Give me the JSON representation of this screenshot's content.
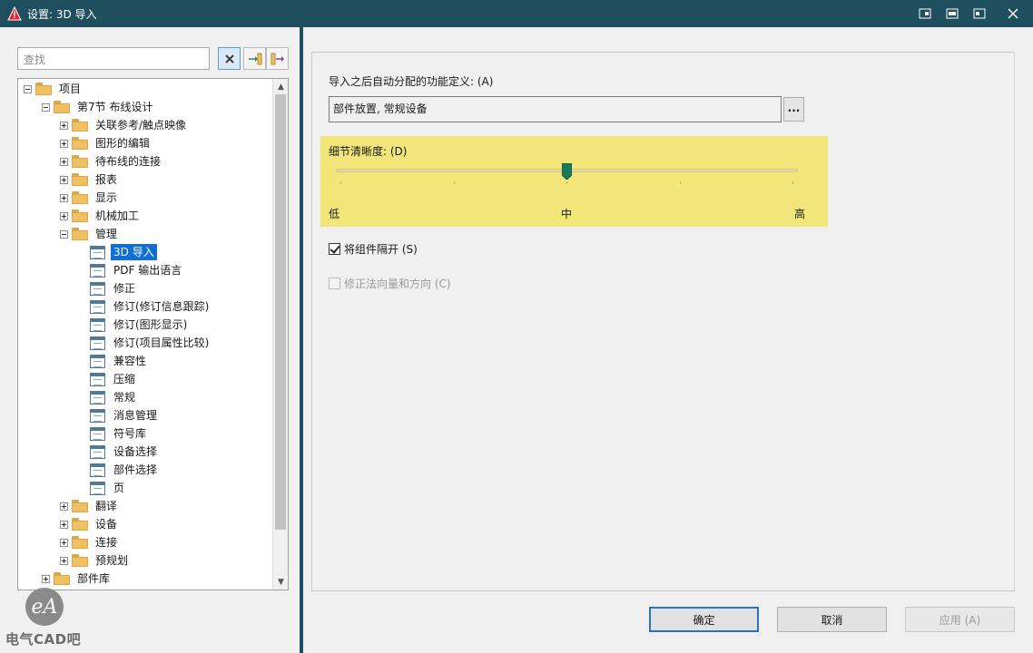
{
  "window": {
    "title": "设置: 3D 导入",
    "title_icon": "warning-triangle-icon",
    "controls": [
      "restore-icon",
      "maximize-icon",
      "minimize-icon",
      "close-icon"
    ]
  },
  "search": {
    "placeholder": "查找"
  },
  "toolbar": {
    "buttons": [
      "clear-filter-icon",
      "expand-all-icon",
      "collapse-all-icon"
    ]
  },
  "tree": [
    {
      "label": "项目",
      "level": 0,
      "expander": "minus",
      "icon": "folder"
    },
    {
      "label": "第7节 布线设计",
      "level": 1,
      "expander": "minus",
      "icon": "folder"
    },
    {
      "label": "关联参考/触点映像",
      "level": 2,
      "expander": "plus",
      "icon": "folder"
    },
    {
      "label": "图形的编辑",
      "level": 2,
      "expander": "plus",
      "icon": "folder"
    },
    {
      "label": "待布线的连接",
      "level": 2,
      "expander": "plus",
      "icon": "folder"
    },
    {
      "label": "报表",
      "level": 2,
      "expander": "plus",
      "icon": "folder"
    },
    {
      "label": "显示",
      "level": 2,
      "expander": "plus",
      "icon": "folder"
    },
    {
      "label": "机械加工",
      "level": 2,
      "expander": "plus",
      "icon": "folder"
    },
    {
      "label": "管理",
      "level": 2,
      "expander": "minus",
      "icon": "folder"
    },
    {
      "label": "3D 导入",
      "level": 3,
      "icon": "page",
      "selected": true
    },
    {
      "label": "PDF 输出语言",
      "level": 3,
      "icon": "page"
    },
    {
      "label": "修正",
      "level": 3,
      "icon": "page"
    },
    {
      "label": "修订(修订信息跟踪)",
      "level": 3,
      "icon": "page"
    },
    {
      "label": "修订(图形显示)",
      "level": 3,
      "icon": "page"
    },
    {
      "label": "修订(项目属性比较)",
      "level": 3,
      "icon": "page"
    },
    {
      "label": "兼容性",
      "level": 3,
      "icon": "page"
    },
    {
      "label": "压缩",
      "level": 3,
      "icon": "page"
    },
    {
      "label": "常规",
      "level": 3,
      "icon": "page"
    },
    {
      "label": "消息管理",
      "level": 3,
      "icon": "page"
    },
    {
      "label": "符号库",
      "level": 3,
      "icon": "page"
    },
    {
      "label": "设备选择",
      "level": 3,
      "icon": "page"
    },
    {
      "label": "部件选择",
      "level": 3,
      "icon": "page"
    },
    {
      "label": "页",
      "level": 3,
      "icon": "page"
    },
    {
      "label": "翻译",
      "level": 2,
      "expander": "plus",
      "icon": "folder"
    },
    {
      "label": "设备",
      "level": 2,
      "expander": "plus",
      "icon": "folder"
    },
    {
      "label": "连接",
      "level": 2,
      "expander": "plus",
      "icon": "folder"
    },
    {
      "label": "预规划",
      "level": 2,
      "expander": "plus",
      "icon": "folder"
    },
    {
      "label": "部件库",
      "level": 1,
      "expander": "plus",
      "icon": "folder"
    }
  ],
  "watermark": {
    "logo_text": "eA",
    "text": "电气CAD吧"
  },
  "settings": {
    "func_label": "导入之后自动分配的功能定义: (A)",
    "func_value": "部件放置, 常规设备",
    "func_button": "...",
    "detail_label": "细节清晰度: (D)",
    "detail_level": 0.5,
    "scale_low": "低",
    "scale_mid": "中",
    "scale_high": "高",
    "separate_label": "将组件隔开 (S)",
    "separate_checked": true,
    "normals_label": "修正法向量和方向 (C)",
    "normals_checked": false,
    "normals_enabled": false
  },
  "buttons": {
    "ok": "确定",
    "cancel": "取消",
    "apply": "应用 (A)"
  },
  "colors": {
    "titlebar": "#1f4f5e",
    "selection": "#0f6fd6",
    "detail_highlight": "#f2e67a",
    "slider_thumb": "#1a7a5e"
  }
}
